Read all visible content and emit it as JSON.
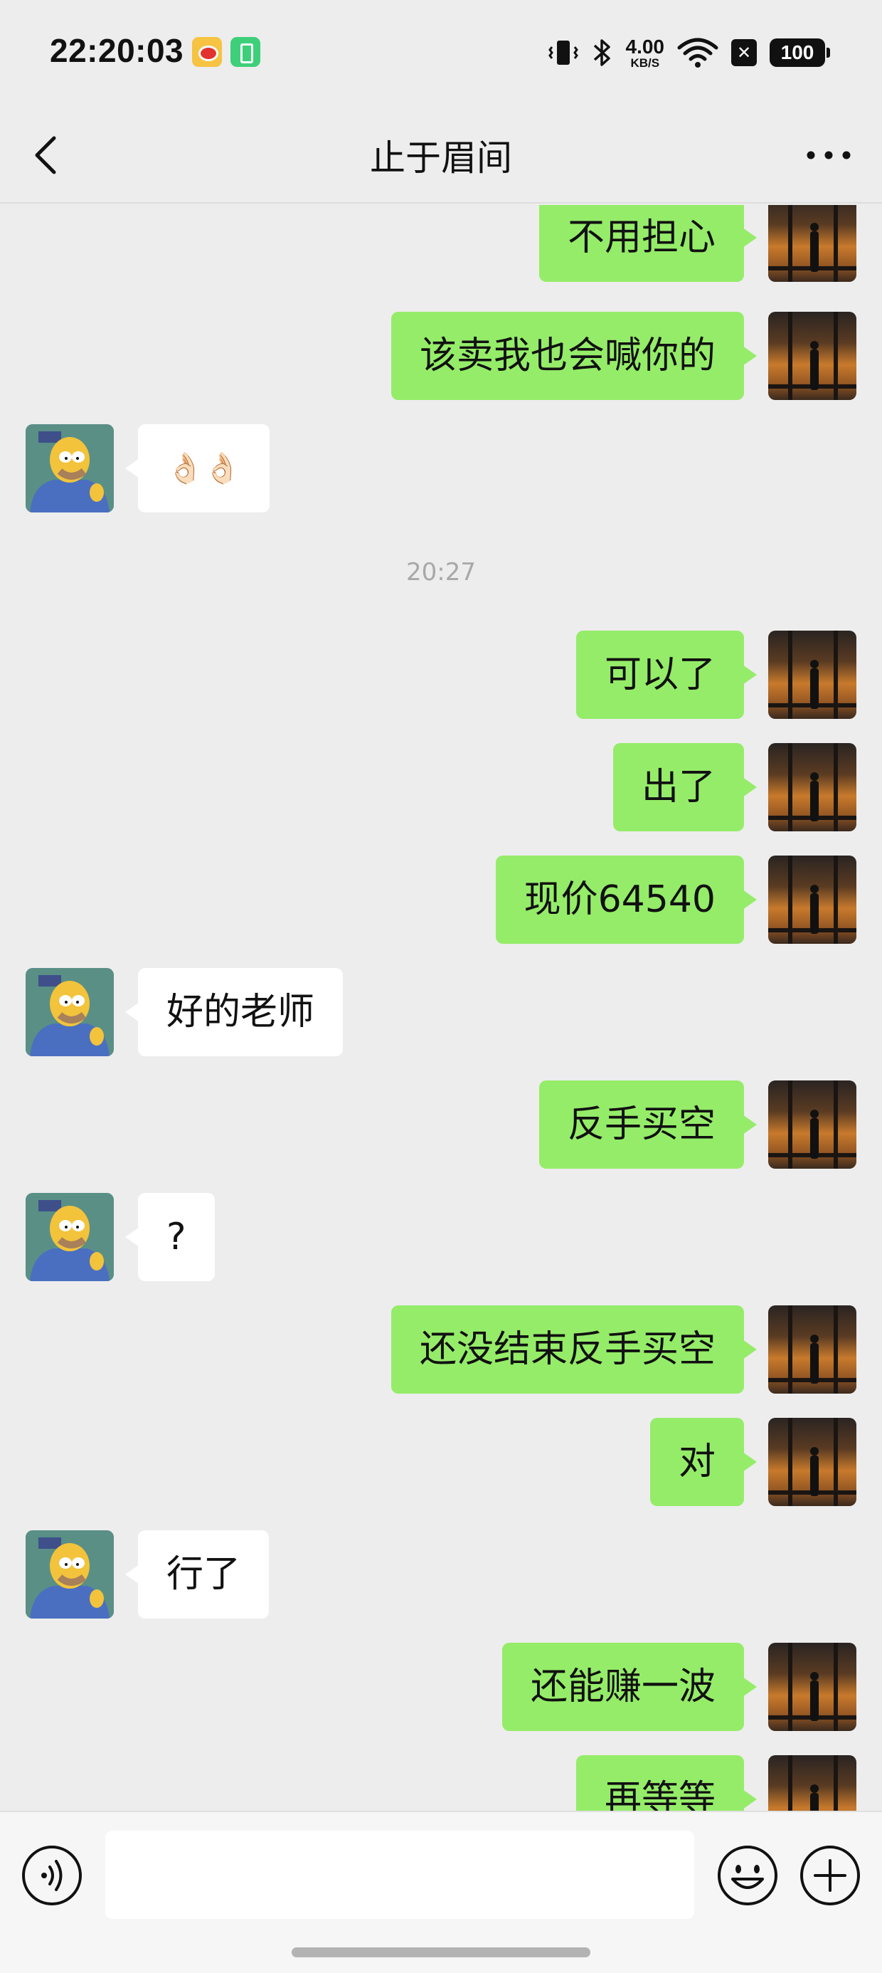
{
  "status_bar": {
    "time": "22:20:03",
    "net_speed_value": "4.00",
    "net_speed_unit": "KB/S",
    "battery": "100",
    "icons": [
      "weibo-app-icon",
      "battery-saver-icon",
      "vibrate-icon",
      "bluetooth-icon",
      "wifi-icon",
      "close-box-icon"
    ]
  },
  "header": {
    "title": "止于眉间",
    "back_icon": "chevron-left-icon",
    "more_icon": "more-dots-icon"
  },
  "chat": {
    "timestamp": "20:27",
    "messages": [
      {
        "side": "out",
        "text": "不用担心"
      },
      {
        "side": "out",
        "text": "该卖我也会喊你的"
      },
      {
        "side": "in",
        "text": "👌🏻👌🏻"
      },
      {
        "side": "out",
        "text": "可以了"
      },
      {
        "side": "out",
        "text": "出了"
      },
      {
        "side": "out",
        "text": "现价64540"
      },
      {
        "side": "in",
        "text": "好的老师"
      },
      {
        "side": "out",
        "text": "反手买空"
      },
      {
        "side": "in",
        "text": "?"
      },
      {
        "side": "out",
        "text": "还没结束反手买空"
      },
      {
        "side": "out",
        "text": "对"
      },
      {
        "side": "in",
        "text": "行了"
      },
      {
        "side": "out",
        "text": "还能赚一波"
      },
      {
        "side": "out",
        "text": "再等等"
      }
    ]
  },
  "input_bar": {
    "voice_icon": "voice-input-icon",
    "input_value": "",
    "emoji_icon": "emoji-icon",
    "plus_icon": "plus-icon"
  },
  "colors": {
    "background": "#ededed",
    "outgoing_bubble": "#95ec69",
    "incoming_bubble": "#ffffff",
    "timestamp_text": "#a8a8a8"
  }
}
